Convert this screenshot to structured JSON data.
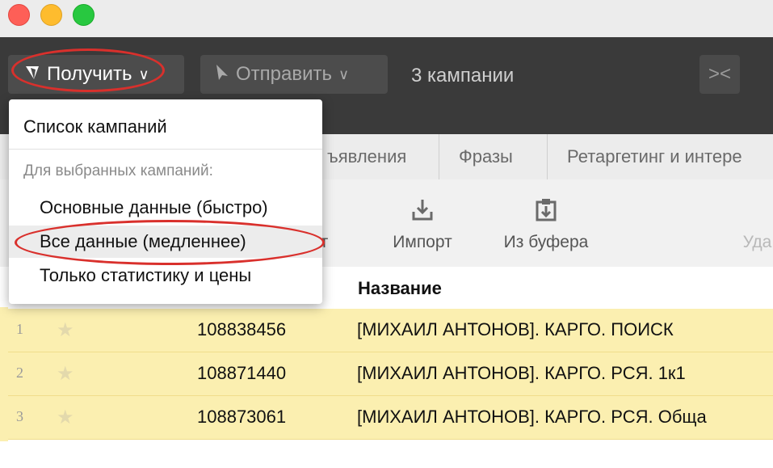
{
  "window": {
    "close": "close",
    "minimize": "minimize",
    "zoom": "zoom"
  },
  "toolbar": {
    "get_label": "Получить",
    "send_label": "Отправить",
    "campaign_count": "3 кампании",
    "chevron": "∨",
    "collapse_icon": "><"
  },
  "tabs": [
    "ъявления",
    "Фразы",
    "Ретаргетинг и интере"
  ],
  "actions": [
    {
      "label": "орт",
      "icon": "export-icon"
    },
    {
      "label": "Импорт",
      "icon": "import-icon"
    },
    {
      "label": "Из буфера",
      "icon": "paste-from-clipboard-icon"
    },
    {
      "label": "Уда",
      "icon": "delete-icon"
    }
  ],
  "table": {
    "name_header": "Название",
    "rows": [
      {
        "num": "1",
        "id": "108838456",
        "name": "[МИХАИЛ АНТОНОВ]. КАРГО. ПОИСК"
      },
      {
        "num": "2",
        "id": "108871440",
        "name": "[МИХАИЛ АНТОНОВ]. КАРГО. РСЯ. 1к1"
      },
      {
        "num": "3",
        "id": "108873061",
        "name": "[МИХАИЛ АНТОНОВ]. КАРГО. РСЯ. Обща"
      }
    ]
  },
  "menu": {
    "campaign_list": "Список кампаний",
    "section_header": "Для выбранных кампаний:",
    "basic_data": "Основные данные (быстро)",
    "all_data": "Все данные (медленнее)",
    "stats_prices": "Только статистику и цены"
  },
  "colors": {
    "toolbar": "#3a3a3a",
    "row_highlight": "#fbefb0",
    "annotation": "#d9302c"
  }
}
